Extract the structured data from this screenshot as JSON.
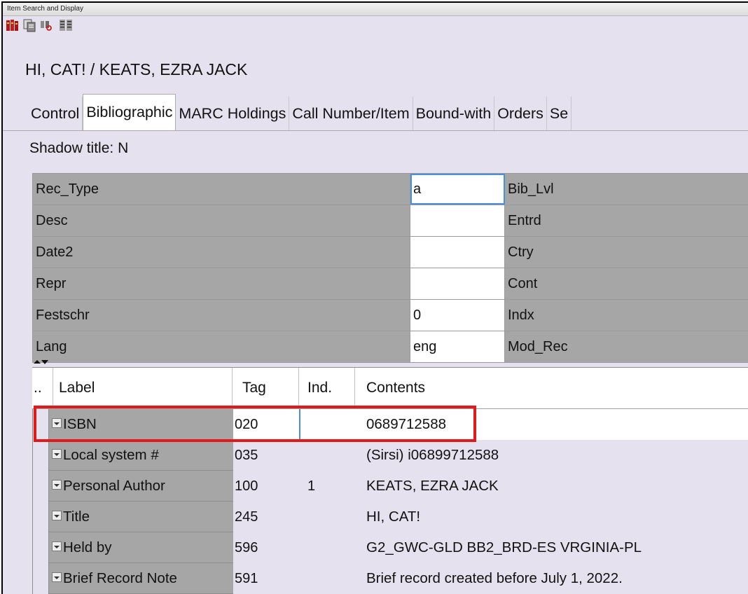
{
  "window": {
    "title": "Item Search and Display"
  },
  "toolbar": {
    "icons": [
      "library-books-icon",
      "copy-record-icon",
      "search-items-icon",
      "display-list-icon"
    ]
  },
  "record": {
    "title": "HI, CAT! / KEATS, EZRA JACK"
  },
  "tabs": [
    "Control",
    "Bibliographic",
    "MARC Holdings",
    "Call Number/Item",
    "Bound-with",
    "Orders",
    "Se"
  ],
  "active_tab": "Bibliographic",
  "shadow_title": "Shadow title: N",
  "fixed_fields": [
    {
      "label": "Rec_Type",
      "value": "a",
      "label2": "Bib_Lvl"
    },
    {
      "label": "Desc",
      "value": "",
      "label2": "Entrd"
    },
    {
      "label": "Date2",
      "value": "",
      "label2": "Ctry"
    },
    {
      "label": "Repr",
      "value": "",
      "label2": "Cont"
    },
    {
      "label": "Festschr",
      "value": "0",
      "label2": "Indx"
    },
    {
      "label": "Lang",
      "value": "eng",
      "label2": "Mod_Rec"
    }
  ],
  "var_headers": {
    "dots": "..",
    "label": "Label",
    "tag": "Tag",
    "ind": "Ind.",
    "contents": "Contents"
  },
  "var_fields": [
    {
      "label": "ISBN",
      "tag": "020",
      "ind": "",
      "contents": "0689712588"
    },
    {
      "label": "Local system #",
      "tag": "035",
      "ind": "",
      "contents": "(Sirsi) i06899712588"
    },
    {
      "label": "Personal Author",
      "tag": "100",
      "ind": "1",
      "contents": "KEATS, EZRA JACK"
    },
    {
      "label": "Title",
      "tag": "245",
      "ind": "",
      "contents": "HI, CAT!"
    },
    {
      "label": "Held by",
      "tag": "596",
      "ind": "",
      "contents": "G2_GWC-GLD BB2_BRD-ES VRGINIA-PL"
    },
    {
      "label": "Brief Record Note",
      "tag": "591",
      "ind": "",
      "contents": "Brief record created before July 1, 2022."
    }
  ],
  "colors": {
    "highlight": "#e11919",
    "background": "#e6e1ef",
    "label_cell": "#a6a6a6",
    "selection": "#4a90d9"
  }
}
